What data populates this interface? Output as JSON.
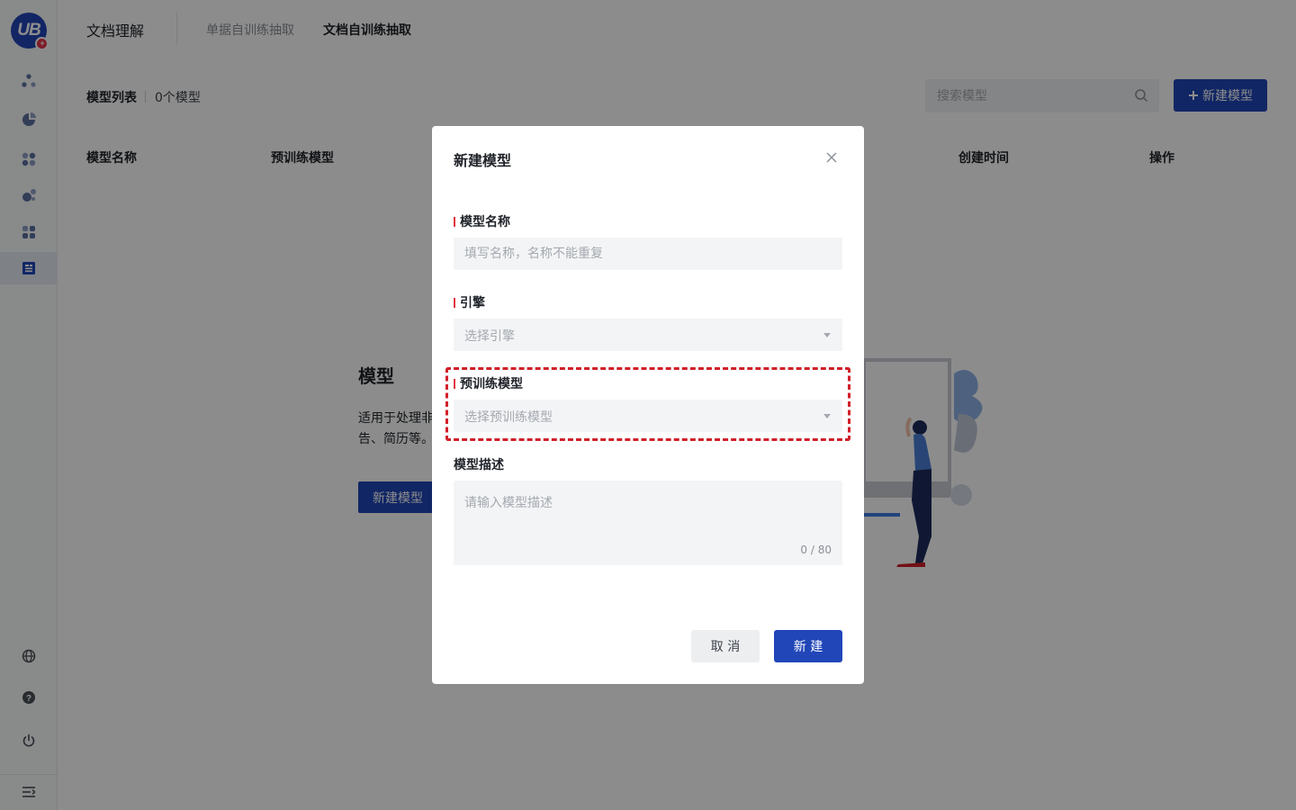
{
  "sidebar": {
    "logo_text": "UB",
    "logo_badge": "+",
    "items": [
      {
        "icon": "nodes-icon"
      },
      {
        "icon": "pie-chart-icon"
      },
      {
        "icon": "apps-icon"
      },
      {
        "icon": "molecule-icon"
      },
      {
        "icon": "blocks-icon"
      },
      {
        "icon": "document-extract-icon",
        "active": true
      }
    ],
    "bottom_items": [
      {
        "icon": "globe-icon"
      },
      {
        "icon": "help-icon"
      },
      {
        "icon": "power-icon"
      },
      {
        "icon": "collapse-menu-icon"
      }
    ]
  },
  "header": {
    "title": "文档理解",
    "tabs": [
      {
        "label": "单据自训练抽取"
      },
      {
        "label": "文档自训练抽取",
        "active": true
      }
    ]
  },
  "list": {
    "title": "模型列表",
    "count": "0个模型",
    "search_placeholder": "搜索模型",
    "new_button": "新建模型",
    "columns": [
      "模型名称",
      "预训练模型",
      "创建时间",
      "操作"
    ]
  },
  "empty_state": {
    "title": "模型",
    "desc_line1": "适用于处理非",
    "desc_line2": "告、简历等。",
    "button": "新建模型"
  },
  "modal": {
    "title": "新建模型",
    "fields": {
      "name": {
        "label": "模型名称",
        "placeholder": "填写名称，名称不能重复"
      },
      "engine": {
        "label": "引擎",
        "placeholder": "选择引擎"
      },
      "pretrained": {
        "label": "预训练模型",
        "placeholder": "选择预训练模型"
      },
      "description": {
        "label": "模型描述",
        "placeholder": "请输入模型描述",
        "counter": "0 / 80"
      }
    },
    "cancel": "取 消",
    "create": "新 建"
  },
  "colors": {
    "brand": "#2046b8",
    "required": "#e0323d",
    "highlight": "#d0202a"
  }
}
